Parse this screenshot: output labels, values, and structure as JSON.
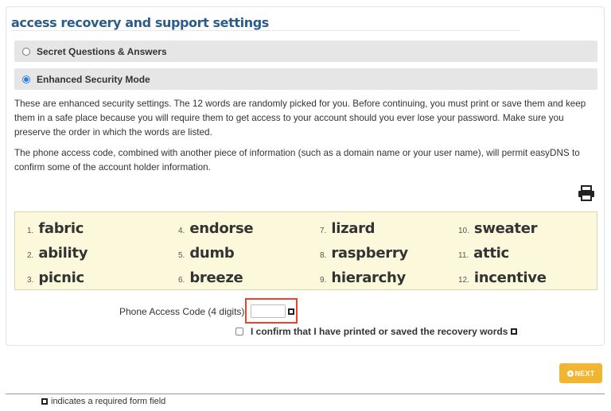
{
  "page_title": "access recovery and support settings",
  "options": [
    {
      "label": "Secret Questions & Answers",
      "selected": false
    },
    {
      "label": "Enhanced Security Mode",
      "selected": true
    }
  ],
  "paragraphs": [
    "These are enhanced security settings. The 12 words are randomly picked for you. Before continuing, you must print or save them and keep them in a safe place because you will require them to get access to your account should you ever lose your password. Make sure you preserve the order in which the words are listed.",
    "The phone access code, combined with another piece of information (such as a domain name or your user name), will permit easyDNS to confirm some of the account holder information."
  ],
  "print_icon": "printer-icon",
  "recovery_words": [
    {
      "num": "1.",
      "word": "fabric"
    },
    {
      "num": "2.",
      "word": "ability"
    },
    {
      "num": "3.",
      "word": "picnic"
    },
    {
      "num": "4.",
      "word": "endorse"
    },
    {
      "num": "5.",
      "word": "dumb"
    },
    {
      "num": "6.",
      "word": "breeze"
    },
    {
      "num": "7.",
      "word": "lizard"
    },
    {
      "num": "8.",
      "word": "raspberry"
    },
    {
      "num": "9.",
      "word": "hierarchy"
    },
    {
      "num": "10.",
      "word": "sweater"
    },
    {
      "num": "11.",
      "word": "attic"
    },
    {
      "num": "12.",
      "word": "incentive"
    }
  ],
  "phone_access_code": {
    "label": "Phone Access Code (4 digits):",
    "value": ""
  },
  "confirm_label": "I confirm that I have printed or saved the recovery words",
  "next_button": "NEXT",
  "footer_note": "indicates a required form field",
  "colors": {
    "title": "#2a5c8c",
    "accent": "#f2b531",
    "highlight_border": "#e8452c",
    "words_bg": "#fbf8dc"
  }
}
